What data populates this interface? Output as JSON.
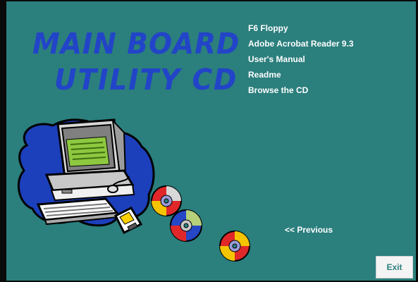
{
  "window": {
    "title_lines": [
      "MAIN BOARD",
      "UTILITY  CD"
    ]
  },
  "menu": {
    "items": [
      {
        "label": "F6 Floppy"
      },
      {
        "label": "Adobe Acrobat Reader 9.3"
      },
      {
        "label": "User's Manual"
      },
      {
        "label": "Readme"
      },
      {
        "label": "Browse the CD"
      }
    ]
  },
  "navigation": {
    "previous_label": "<< Previous",
    "exit_label": "Exit"
  },
  "theme": {
    "background": "#2b7f7d",
    "title_color": "#2244c8",
    "text_color": "#ffffff"
  },
  "icons": {
    "illustration": "computer-with-cds-illustration"
  }
}
